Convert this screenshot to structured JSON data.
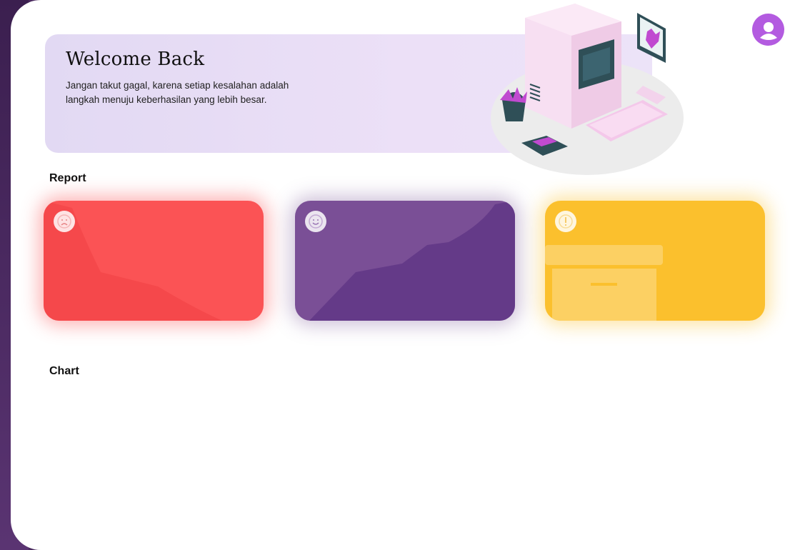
{
  "header": {
    "welcome_title": "Welcome Back",
    "welcome_subtitle": "Jangan takut gagal, karena setiap kesalahan adalah langkah menuju keberhasilan yang lebih besar.",
    "avatar_icon": "user-icon"
  },
  "sections": {
    "report_label": "Report",
    "chart_label": "Chart"
  },
  "report_cards": [
    {
      "icon": "sad-face-icon",
      "color": "#fb5355"
    },
    {
      "icon": "smile-face-icon",
      "color": "#7a4f96"
    },
    {
      "icon": "alert-icon",
      "color": "#fbc02d"
    }
  ],
  "colors": {
    "sidebar": "#4a2a5e",
    "banner": "#e8def6",
    "avatar": "#b35be0"
  }
}
